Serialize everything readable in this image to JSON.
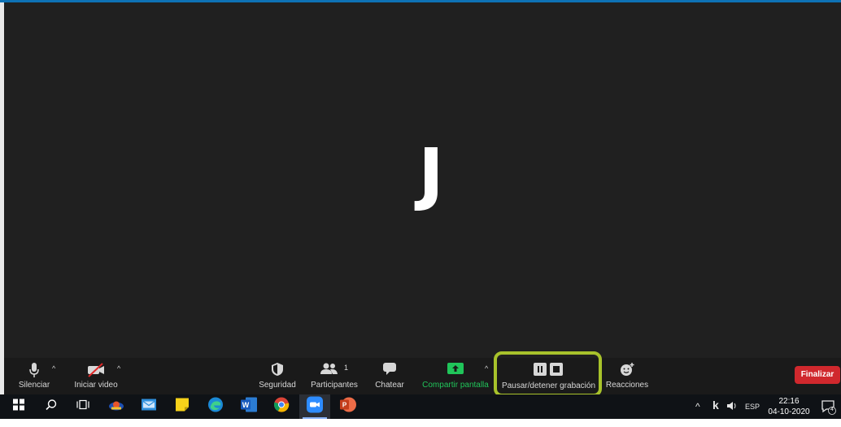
{
  "meeting": {
    "participant_initial": "J"
  },
  "toolbar": {
    "mute_label": "Silenciar",
    "video_label": "Iniciar video",
    "security_label": "Seguridad",
    "participants_label": "Participantes",
    "participants_count": "1",
    "chat_label": "Chatear",
    "share_label": "Compartir pantalla",
    "record_label": "Pausar/detener grabación",
    "reactions_label": "Reacciones",
    "end_label": "Finalizar"
  },
  "colors": {
    "stage_bg": "#202020",
    "toolbar_bg": "#1a1a1a",
    "share_green": "#20c55a",
    "highlight": "#a8c22b",
    "end_red": "#d0282d"
  },
  "taskbar": {
    "apps": [
      "start-icon",
      "search-icon",
      "task-view-icon",
      "app-icon",
      "mail-icon",
      "sticky-notes-icon",
      "edge-icon",
      "word-icon",
      "chrome-icon",
      "zoom-icon",
      "powerpoint-icon"
    ],
    "language": "ESP",
    "time": "22:16",
    "date": "04-10-2020",
    "notification_count": "4",
    "k_label": "k"
  }
}
